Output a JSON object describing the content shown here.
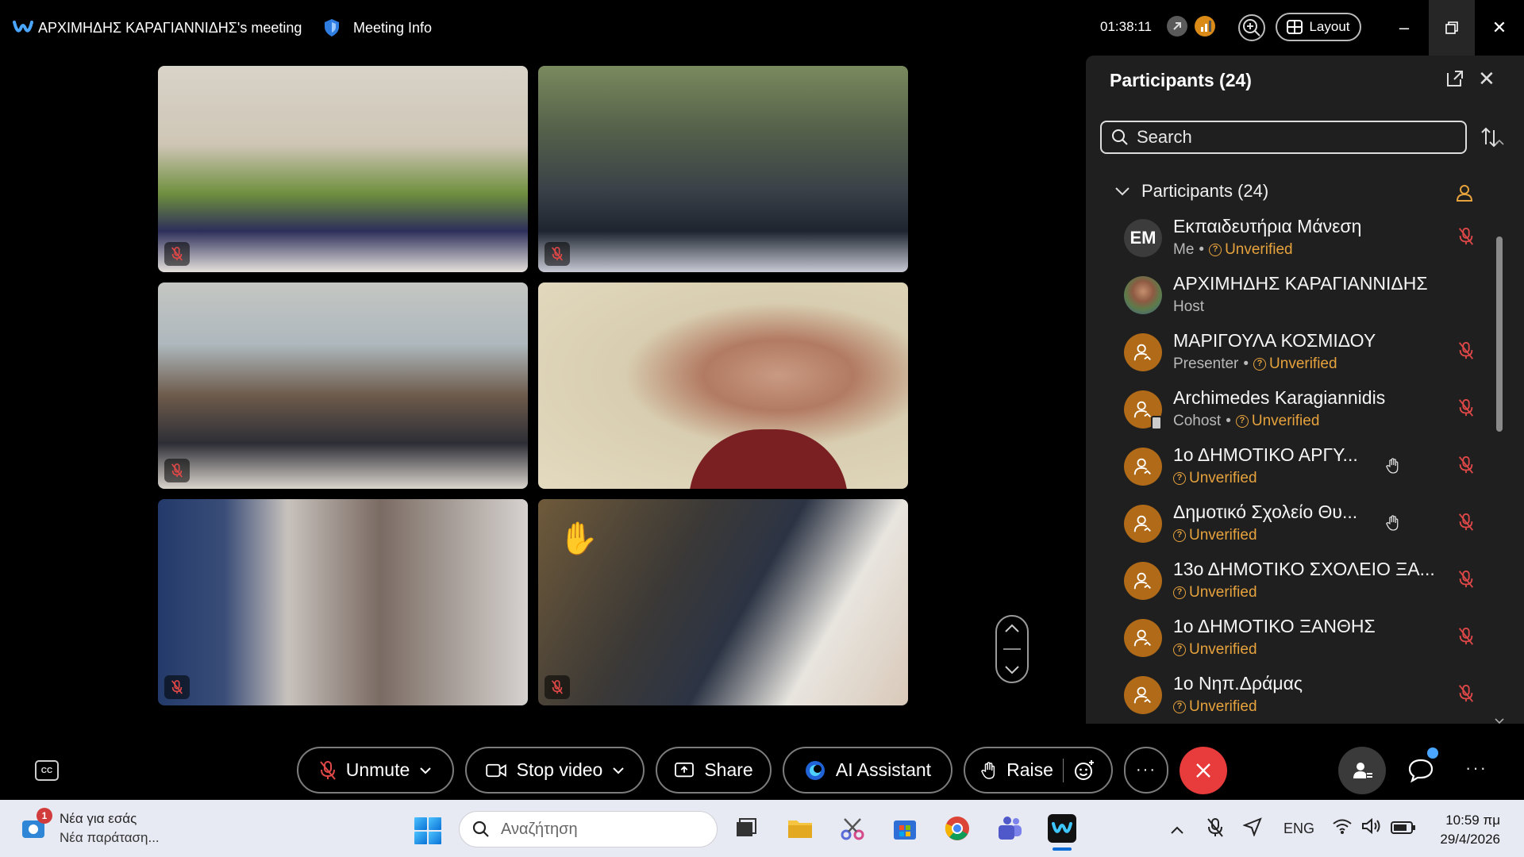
{
  "titlebar": {
    "meeting_title": "ΑΡΧΙΜΗΔΗΣ ΚΑΡΑΓΙΑΝΝΙΔΗΣ's meeting",
    "meeting_info": "Meeting Info",
    "timer": "01:38:11",
    "layout_label": "Layout"
  },
  "panel": {
    "title": "Participants (24)",
    "search_placeholder": "Search",
    "group_label": "Participants (24)",
    "participants": [
      {
        "initials": "EM",
        "name": "Εκπαιδευτήρια Μάνεση",
        "role": "Me",
        "status": "Unverified",
        "muted": true,
        "hand": false,
        "avatar": "initials"
      },
      {
        "initials": "",
        "name": "ΑΡΧΙΜΗΔΗΣ ΚΑΡΑΓΙΑΝΝΙΔΗΣ",
        "role": "Host",
        "status": "",
        "muted": false,
        "hand": false,
        "avatar": "photo"
      },
      {
        "initials": "",
        "name": "ΜΑΡΙΓΟΥΛΑ ΚΟΣΜΙΔΟΥ",
        "role": "Presenter",
        "status": "Unverified",
        "muted": true,
        "hand": false,
        "avatar": "generic"
      },
      {
        "initials": "",
        "name": "Archimedes Karagiannidis",
        "role": "Cohost",
        "status": "Unverified",
        "muted": true,
        "hand": false,
        "avatar": "generic"
      },
      {
        "initials": "",
        "name": "1ο ΔΗΜΟΤΙΚΟ ΑΡΓΥ...",
        "role": "",
        "status": "Unverified",
        "muted": true,
        "hand": true,
        "avatar": "generic"
      },
      {
        "initials": "",
        "name": "Δημοτικό Σχολείο Θυ...",
        "role": "",
        "status": "Unverified",
        "muted": true,
        "hand": true,
        "avatar": "generic"
      },
      {
        "initials": "",
        "name": "13ο ΔΗΜΟΤΙΚΟ ΣΧΟΛΕΙΟ ΞΑ...",
        "role": "",
        "status": "Unverified",
        "muted": true,
        "hand": false,
        "avatar": "generic"
      },
      {
        "initials": "",
        "name": "1ο ΔΗΜΟΤΙΚΟ ΞΑΝΘΗΣ",
        "role": "",
        "status": "Unverified",
        "muted": true,
        "hand": false,
        "avatar": "generic"
      },
      {
        "initials": "",
        "name": "1ο Νηπ.Δράμας",
        "role": "",
        "status": "Unverified",
        "muted": true,
        "hand": false,
        "avatar": "generic"
      }
    ]
  },
  "controls": {
    "unmute": "Unmute",
    "stop_video": "Stop video",
    "share": "Share",
    "ai_assistant": "AI Assistant",
    "raise": "Raise",
    "cc": "CC"
  },
  "taskbar": {
    "news_title": "Νέα για εσάς",
    "news_subtitle": "Νέα παράταση...",
    "news_badge": "1",
    "search_placeholder": "Αναζήτηση",
    "language": "ENG",
    "time": "10:59 πμ",
    "date": "29/4/2026"
  },
  "colors": {
    "accent_unverified": "#e6a23c",
    "end_call": "#e83b3b",
    "mute_red": "#e04848"
  }
}
